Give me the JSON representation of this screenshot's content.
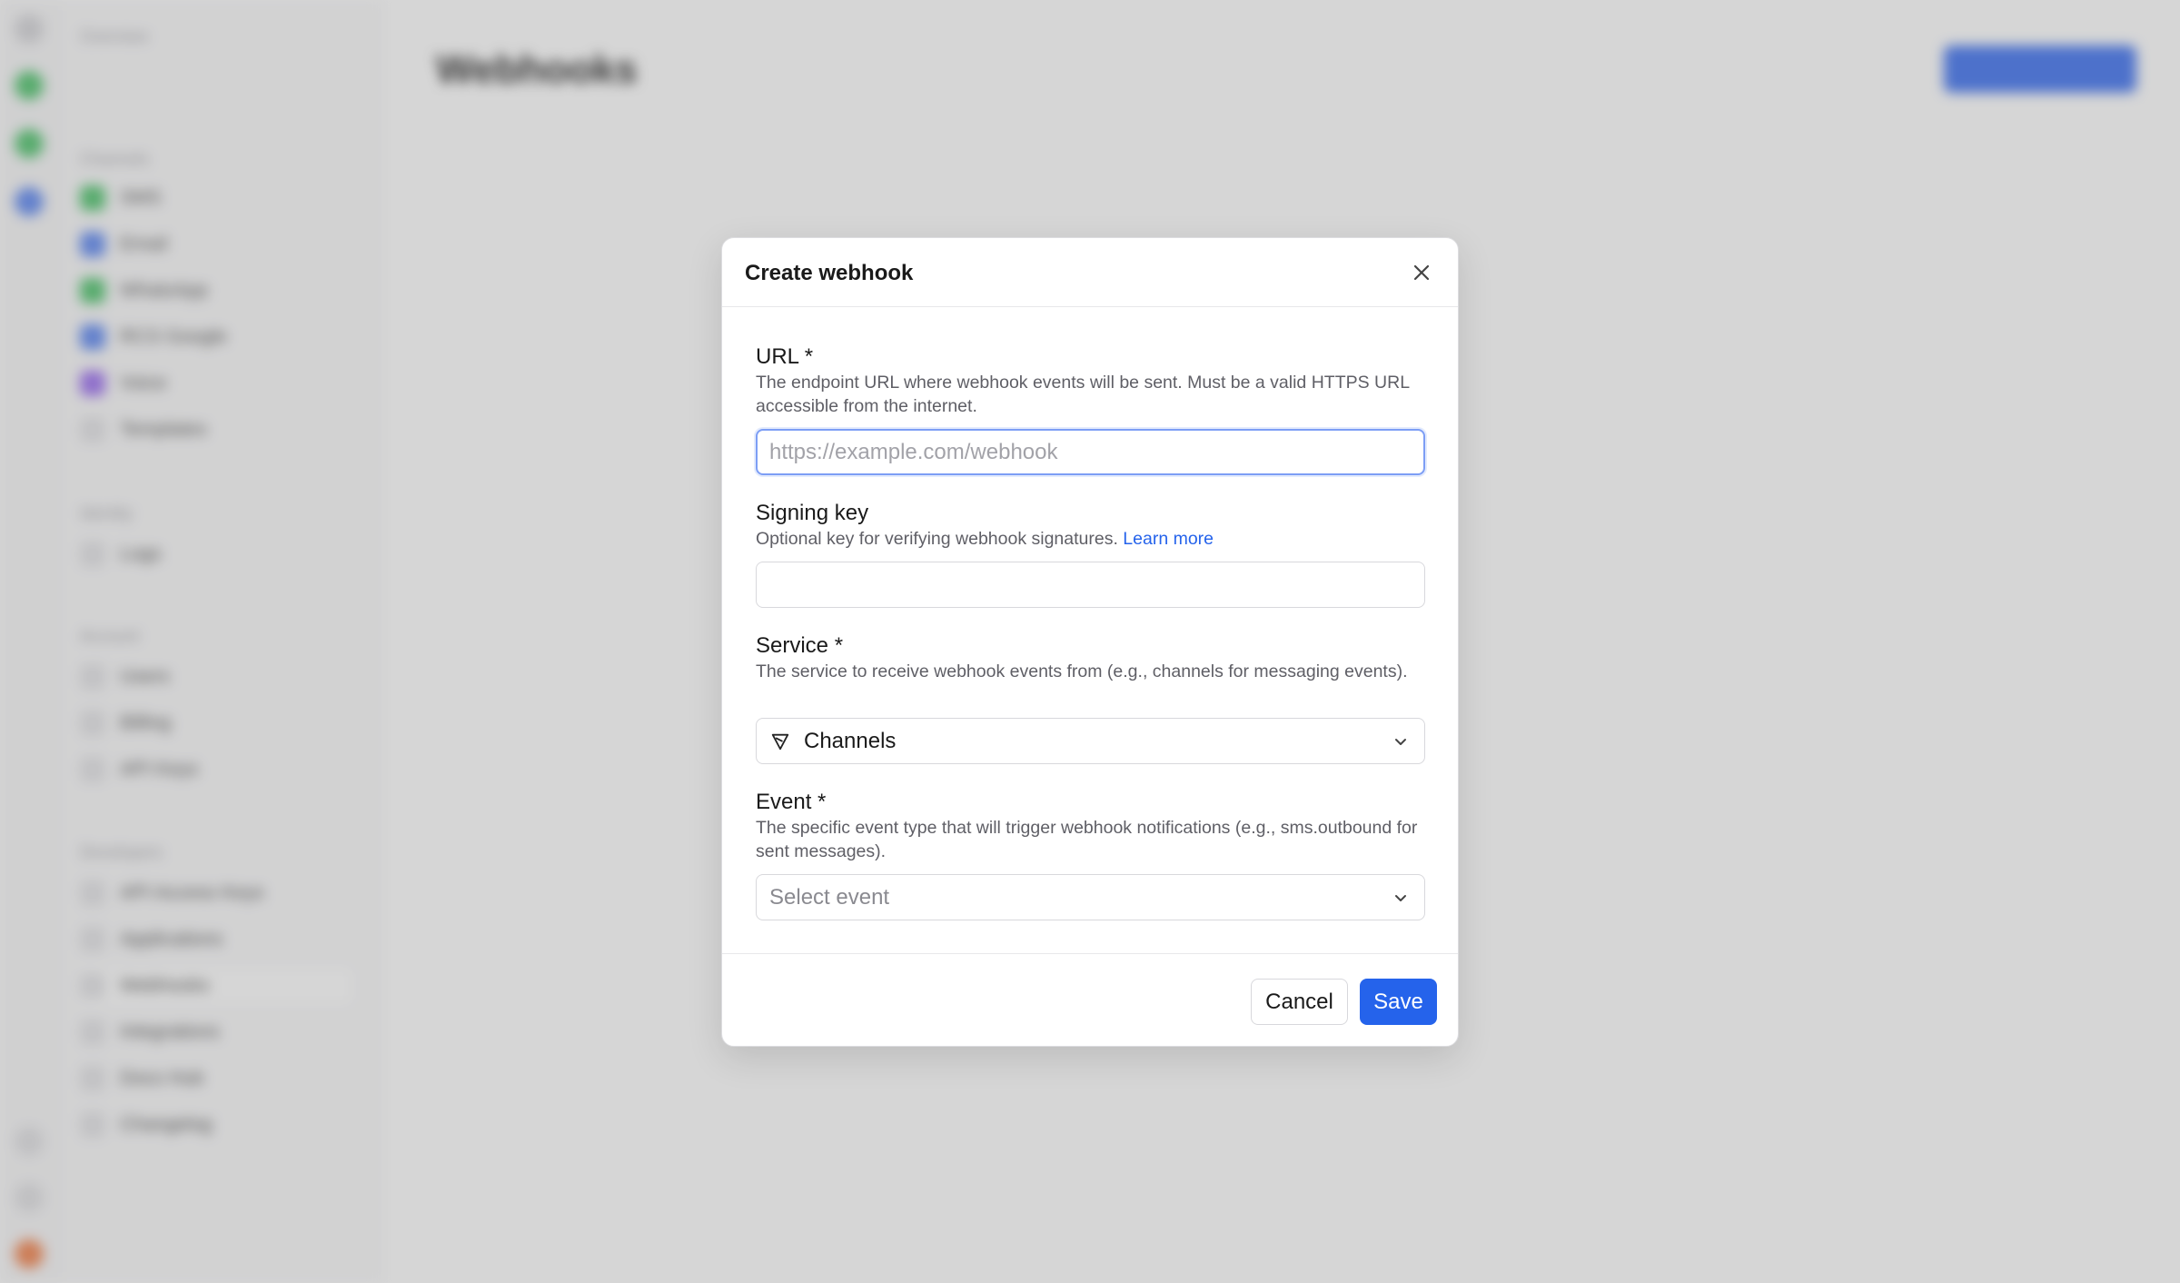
{
  "background": {
    "page_title": "Webhooks",
    "sidebar_sections": [
      "Overview",
      "Channels",
      "Identity",
      "Account",
      "Developers"
    ],
    "sidebar_items": [
      "SMS",
      "Email",
      "WhatsApp",
      "RCS Google",
      "Voice",
      "Templates",
      "Logs",
      "Users",
      "Billing",
      "API Keys",
      "API Access Keys",
      "Applications",
      "Webhooks",
      "Integrations",
      "Docs Hub",
      "Changelog"
    ],
    "primary_action": "Create webhook"
  },
  "modal": {
    "title": "Create webhook",
    "fields": {
      "url": {
        "label": "URL *",
        "description": "The endpoint URL where webhook events will be sent. Must be a valid HTTPS URL accessible from the internet.",
        "placeholder": "https://example.com/webhook",
        "value": ""
      },
      "signing_key": {
        "label": "Signing key",
        "description": "Optional key for verifying webhook signatures.",
        "link": "Learn more",
        "value": ""
      },
      "service": {
        "label": "Service *",
        "description": "The service to receive webhook events from (e.g., channels for messaging events).",
        "selected": "Channels",
        "icon": "send-icon"
      },
      "event": {
        "label": "Event *",
        "description": "The specific event type that will trigger webhook notifications (e.g., sms.outbound for sent messages).",
        "placeholder": "Select event"
      }
    },
    "buttons": {
      "cancel": "Cancel",
      "save": "Save"
    }
  },
  "colors": {
    "primary": "#2563eb",
    "link": "#2563eb",
    "focus_ring": "#7d9ef5"
  }
}
